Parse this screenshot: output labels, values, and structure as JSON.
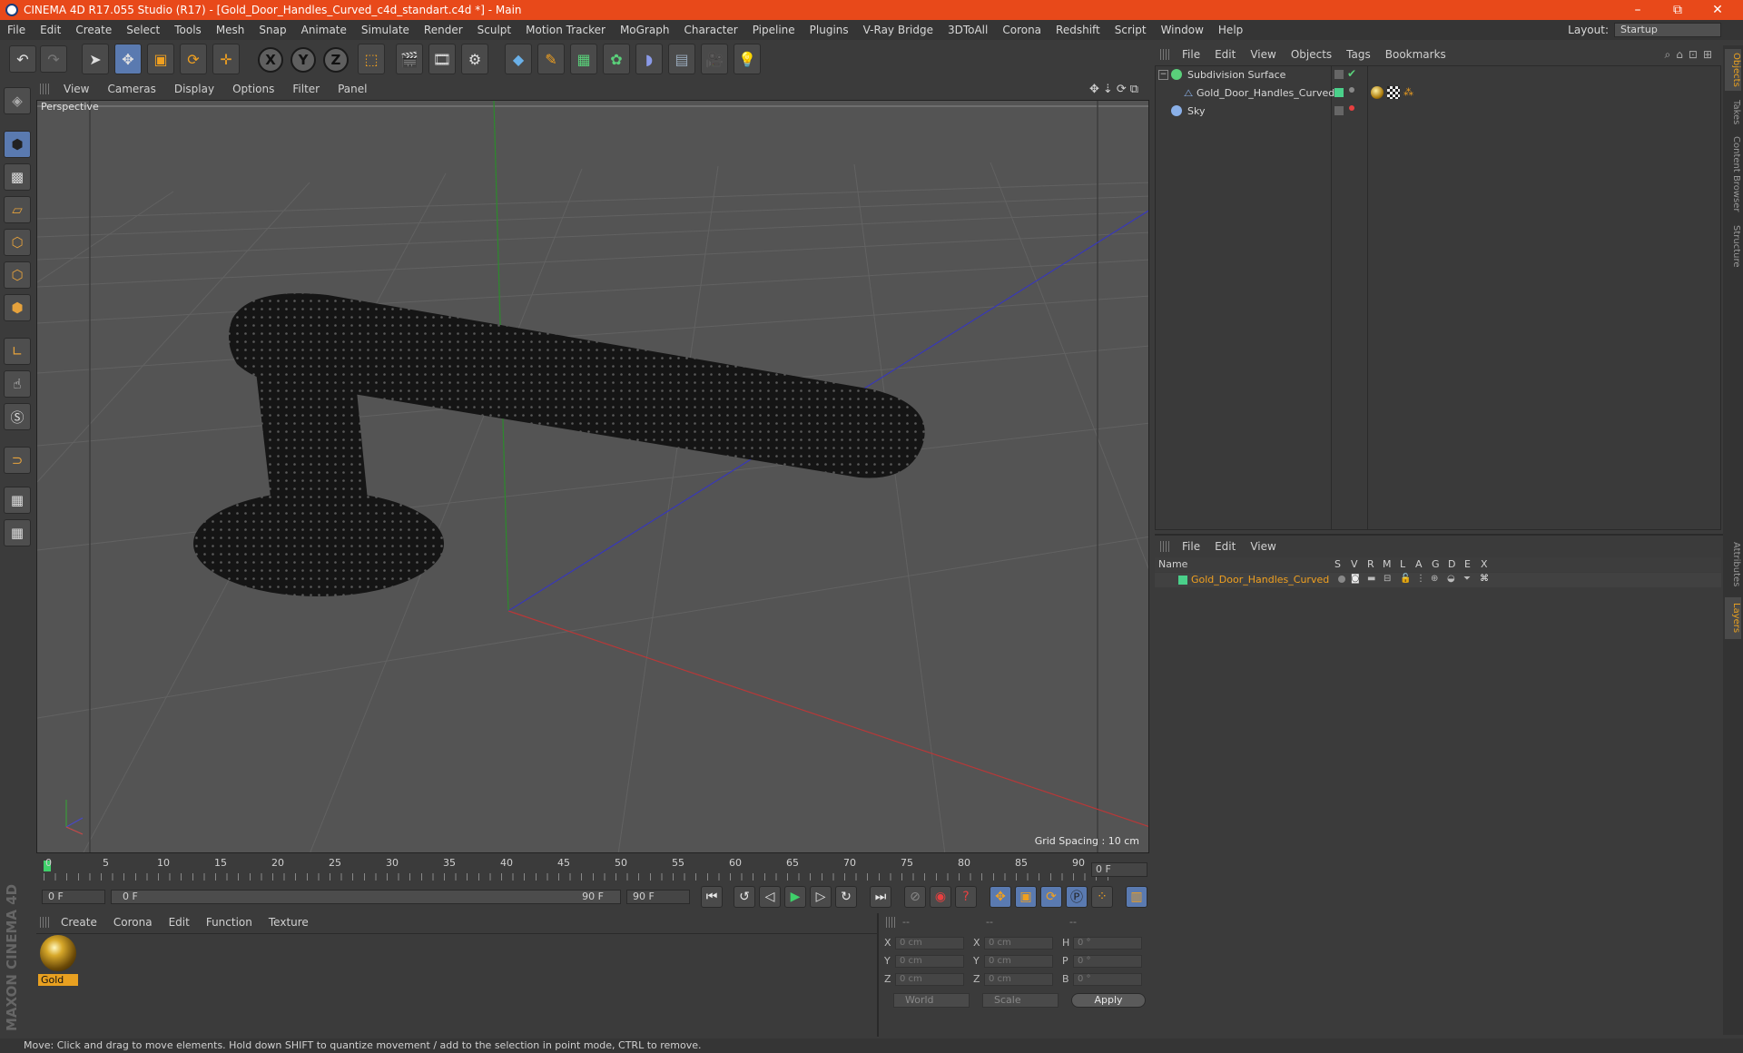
{
  "window": {
    "title": "CINEMA 4D R17.055 Studio (R17) - [Gold_Door_Handles_Curved_c4d_standart.c4d *] - Main",
    "controls": [
      "–",
      "⧉",
      "✕"
    ]
  },
  "menubar": [
    "File",
    "Edit",
    "Create",
    "Select",
    "Tools",
    "Mesh",
    "Snap",
    "Animate",
    "Simulate",
    "Render",
    "Sculpt",
    "Motion Tracker",
    "MoGraph",
    "Character",
    "Pipeline",
    "Plugins",
    "V-Ray Bridge",
    "3DToAll",
    "Corona",
    "Redshift",
    "Script",
    "Window",
    "Help"
  ],
  "layout": {
    "label": "Layout:",
    "value": "Startup"
  },
  "toolbar": {
    "axis_x": "X",
    "axis_y": "Y",
    "axis_z": "Z"
  },
  "viewport": {
    "menu": [
      "View",
      "Cameras",
      "Display",
      "Options",
      "Filter",
      "Panel"
    ],
    "label": "Perspective",
    "grid_spacing": "Grid Spacing : 10 cm"
  },
  "timeline": {
    "ticks": [
      "0",
      "5",
      "10",
      "15",
      "20",
      "25",
      "30",
      "35",
      "40",
      "45",
      "50",
      "55",
      "60",
      "65",
      "70",
      "75",
      "80",
      "85",
      "90"
    ],
    "current_frame": "0 F",
    "start": "0 F",
    "range_start": "0 F",
    "range_end": "90 F",
    "end": "90 F"
  },
  "materials": {
    "menu": [
      "Create",
      "Corona",
      "Edit",
      "Function",
      "Texture"
    ],
    "items": [
      {
        "name": "Gold"
      }
    ]
  },
  "coordinates": {
    "headers": [
      "--",
      "--",
      "--"
    ],
    "rows": [
      {
        "a": "X",
        "av": "0 cm",
        "b": "X",
        "bv": "0 cm",
        "c": "H",
        "cv": "0 °"
      },
      {
        "a": "Y",
        "av": "0 cm",
        "b": "Y",
        "bv": "0 cm",
        "c": "P",
        "cv": "0 °"
      },
      {
        "a": "Z",
        "av": "0 cm",
        "b": "Z",
        "bv": "0 cm",
        "c": "B",
        "cv": "0 °"
      }
    ],
    "mode1": "World",
    "mode2": "Scale",
    "apply": "Apply"
  },
  "objects": {
    "menu": [
      "File",
      "Edit",
      "View",
      "Objects",
      "Tags",
      "Bookmarks"
    ],
    "rows": [
      {
        "name": "Subdivision Surface"
      },
      {
        "name": "Gold_Door_Handles_Curved"
      },
      {
        "name": "Sky"
      }
    ]
  },
  "layers": {
    "menu": [
      "File",
      "Edit",
      "View"
    ],
    "columns": [
      "Name",
      "S",
      "V",
      "R",
      "M",
      "L",
      "A",
      "G",
      "D",
      "E",
      "X"
    ],
    "rows": [
      {
        "name": "Gold_Door_Handles_Curved",
        "color": "#4ad08a"
      }
    ]
  },
  "right_tabs": [
    "Objects",
    "Takes",
    "Content Browser",
    "Structure",
    "Attributes",
    "Layers"
  ],
  "status": "Move: Click and drag to move elements. Hold down SHIFT to quantize movement / add to the selection in point mode, CTRL to remove.",
  "brand": "MAXON CINEMA 4D",
  "colors": {
    "accent": "#e8491a",
    "highlight": "#f0a020",
    "layer": "#4ad08a"
  }
}
